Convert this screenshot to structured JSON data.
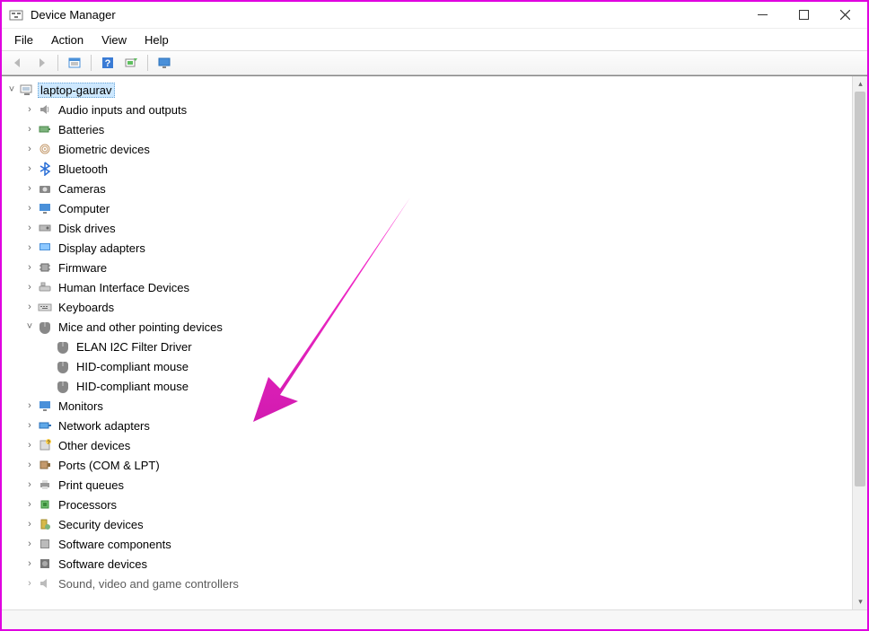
{
  "window": {
    "title": "Device Manager"
  },
  "menu": {
    "file": "File",
    "action": "Action",
    "view": "View",
    "help": "Help"
  },
  "tree": {
    "root": "laptop-gaurav",
    "categories": [
      {
        "label": "Audio inputs and outputs"
      },
      {
        "label": "Batteries"
      },
      {
        "label": "Biometric devices"
      },
      {
        "label": "Bluetooth"
      },
      {
        "label": "Cameras"
      },
      {
        "label": "Computer"
      },
      {
        "label": "Disk drives"
      },
      {
        "label": "Display adapters"
      },
      {
        "label": "Firmware"
      },
      {
        "label": "Human Interface Devices"
      },
      {
        "label": "Keyboards"
      },
      {
        "label": "Mice and other pointing devices",
        "children": [
          "ELAN I2C Filter Driver",
          "HID-compliant mouse",
          "HID-compliant mouse"
        ]
      },
      {
        "label": "Monitors"
      },
      {
        "label": "Network adapters"
      },
      {
        "label": "Other devices"
      },
      {
        "label": "Ports (COM & LPT)"
      },
      {
        "label": "Print queues"
      },
      {
        "label": "Processors"
      },
      {
        "label": "Security devices"
      },
      {
        "label": "Software components"
      },
      {
        "label": "Software devices"
      },
      {
        "label": "Sound, video and game controllers"
      }
    ]
  }
}
